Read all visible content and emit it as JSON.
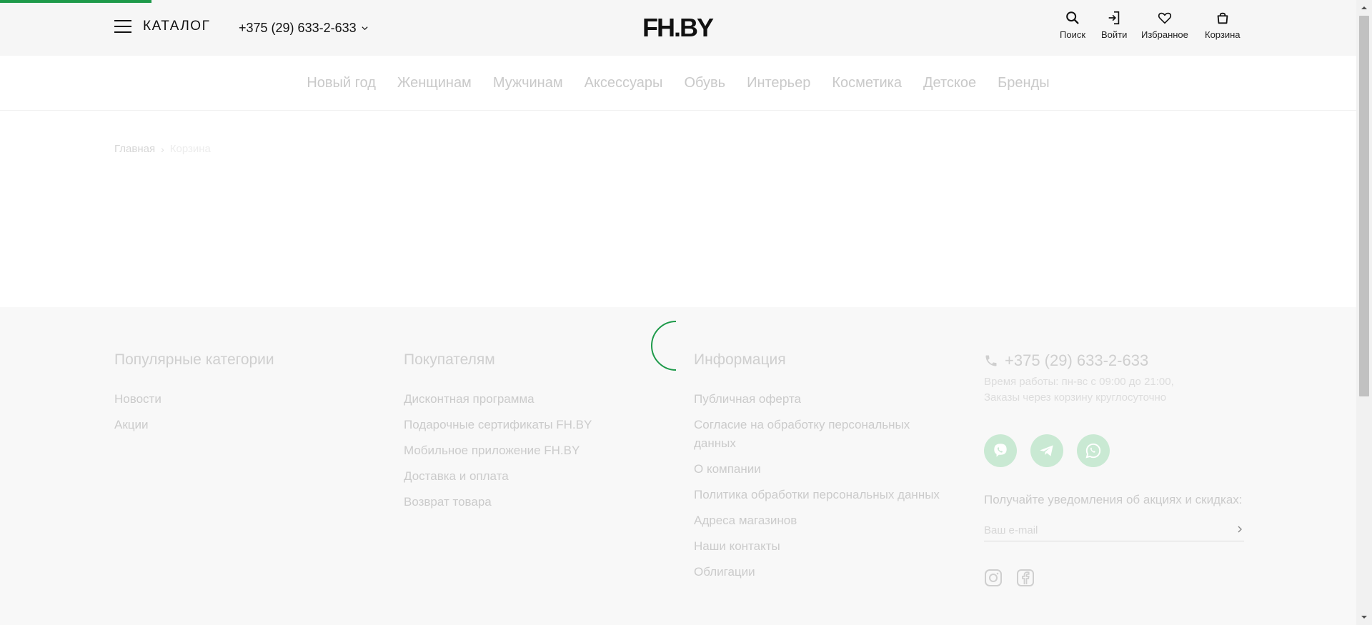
{
  "header": {
    "catalog_label": "КАТАЛОГ",
    "phone": "+375 (29) 633-2-633",
    "logo": "FH.BY",
    "actions": [
      {
        "label": "Поиск",
        "icon": "search-icon"
      },
      {
        "label": "Войти",
        "icon": "login-icon"
      },
      {
        "label": "Избранное",
        "icon": "heart-icon"
      },
      {
        "label": "Корзина",
        "icon": "bag-icon"
      }
    ]
  },
  "nav": {
    "items": [
      "Новый год",
      "Женщинам",
      "Мужчинам",
      "Аксессуары",
      "Обувь",
      "Интерьер",
      "Косметика",
      "Детское",
      "Бренды"
    ]
  },
  "breadcrumb": {
    "home": "Главная",
    "current": "Корзина"
  },
  "footer": {
    "popular": {
      "title": "Популярные категории",
      "links": [
        "Новости",
        "Акции"
      ]
    },
    "customers": {
      "title": "Покупателям",
      "links": [
        "Дисконтная программа",
        "Подарочные сертификаты FH.BY",
        "Мобильное приложение FH.BY",
        "Доставка и оплата",
        "Возврат товара"
      ]
    },
    "info": {
      "title": "Информация",
      "links": [
        "Публичная оферта",
        "Согласие на обработку персональных данных",
        "О компании",
        "Политика обработки персональных данных",
        "Адреса магазинов",
        "Наши контакты",
        "Облигации"
      ]
    },
    "contacts": {
      "phone": "+375 (29) 633-2-633",
      "hours_line1": "Время работы: пн-вс с 09:00 до 21:00,",
      "hours_line2": "Заказы через корзину круглосуточно",
      "messengers": [
        "viber-icon",
        "telegram-icon",
        "whatsapp-icon"
      ],
      "subscribe_label": "Получайте уведомления об акциях и скидках:",
      "email_placeholder": "Ваш e-mail",
      "socials": [
        "instagram-icon",
        "facebook-icon"
      ]
    }
  },
  "colors": {
    "accent": "#1e9a4a",
    "messenger_bg": "#c9e9d3",
    "header_bg": "#f6f6f6",
    "footer_bg": "#f8f8f8"
  }
}
